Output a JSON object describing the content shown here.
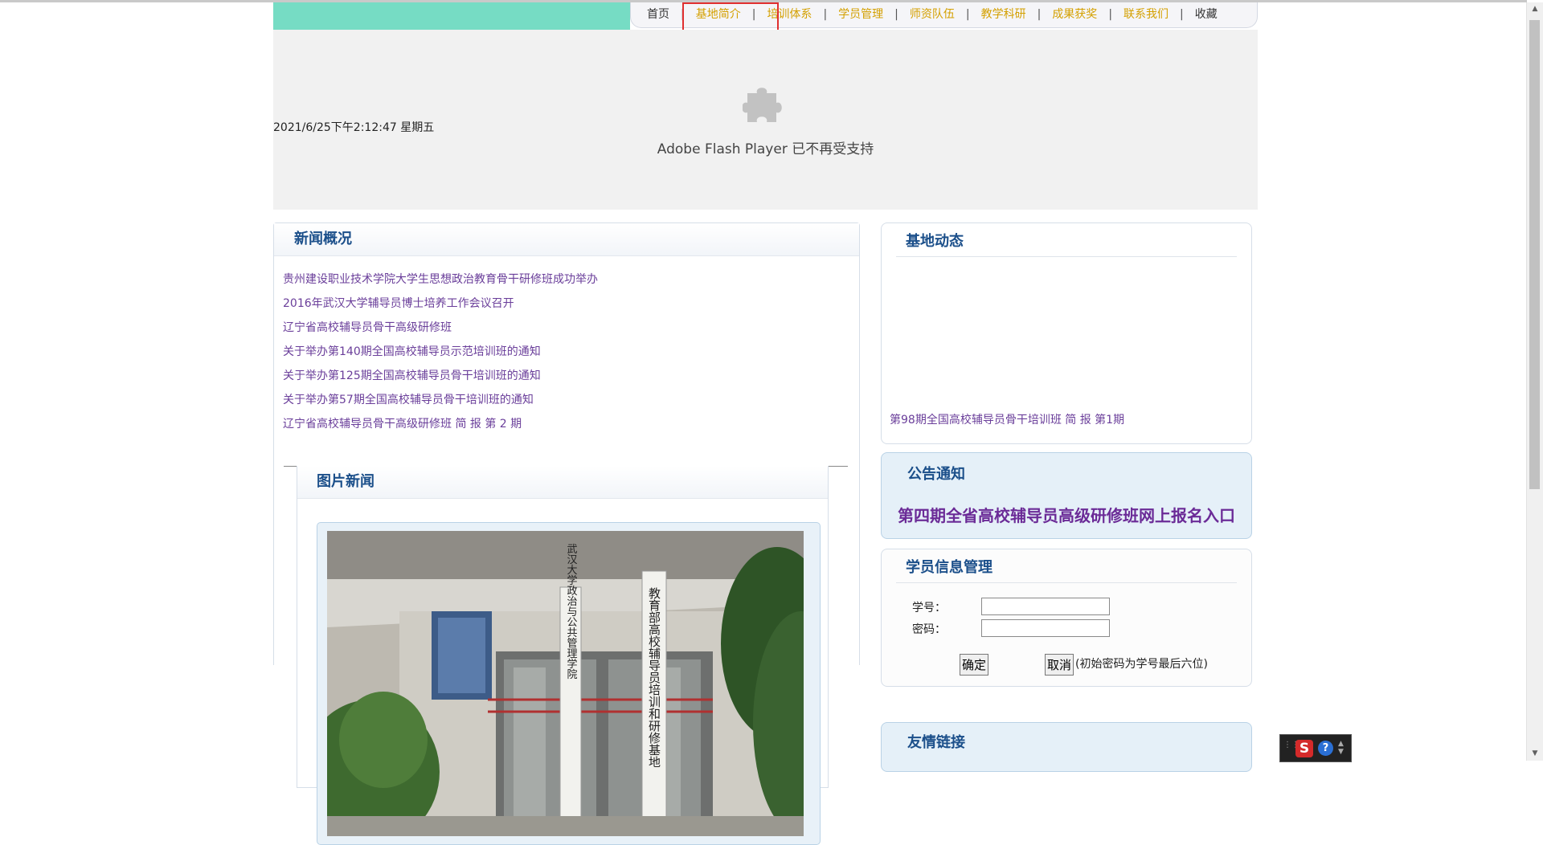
{
  "nav": {
    "items": [
      {
        "label": "首页"
      },
      {
        "label": "基地简介"
      },
      {
        "label": "培训体系"
      },
      {
        "label": "学员管理"
      },
      {
        "label": "师资队伍"
      },
      {
        "label": "教学科研"
      },
      {
        "label": "成果获奖"
      },
      {
        "label": "联系我们"
      },
      {
        "label": "收藏"
      }
    ],
    "separator": "|"
  },
  "flash": {
    "message": "Adobe Flash Player 已不再受支持",
    "datetime": "2021/6/25下午2:12:47 星期五"
  },
  "news": {
    "title": "新闻概况",
    "items": [
      "贵州建设职业技术学院大学生思想政治教育骨干研修班成功举办",
      "2016年武汉大学辅导员博士培养工作会议召开",
      "辽宁省高校辅导员骨干高级研修班",
      "关于举办第140期全国高校辅导员示范培训班的通知",
      "关于举办第125期全国高校辅导员骨干培训班的通知",
      "关于举办第57期全国高校辅导员骨干培训班的通知",
      "辽宁省高校辅导员骨干高级研修班 简 报 第 2 期"
    ]
  },
  "picnews": {
    "title": "图片新闻",
    "sign_left": "武汉大学政治与公共管理学院",
    "sign_right": "教育部高校辅导员培训和研修基地"
  },
  "dynamics": {
    "title": "基地动态",
    "link": "第98期全国高校辅导员骨干培训班 简 报 第1期"
  },
  "notice": {
    "title": "公告通知",
    "link": "第四期全省高校辅导员高级研修班网上报名入口"
  },
  "login": {
    "title": "学员信息管理",
    "id_label": "学号：",
    "pwd_label": "密码：",
    "id_value": "",
    "pwd_value": "",
    "ok": "确定",
    "cancel": "取消",
    "hint": "(初始密码为学号最后六位)"
  },
  "links": {
    "title": "友情链接"
  },
  "tray": {
    "ime": "S",
    "help": "?"
  },
  "colors": {
    "teal": "#76dcc4",
    "nav_text": "#d4a000",
    "title_blue": "#1b4f8a",
    "link_purple": "#6a3e9a",
    "highlight": "#e03030"
  }
}
